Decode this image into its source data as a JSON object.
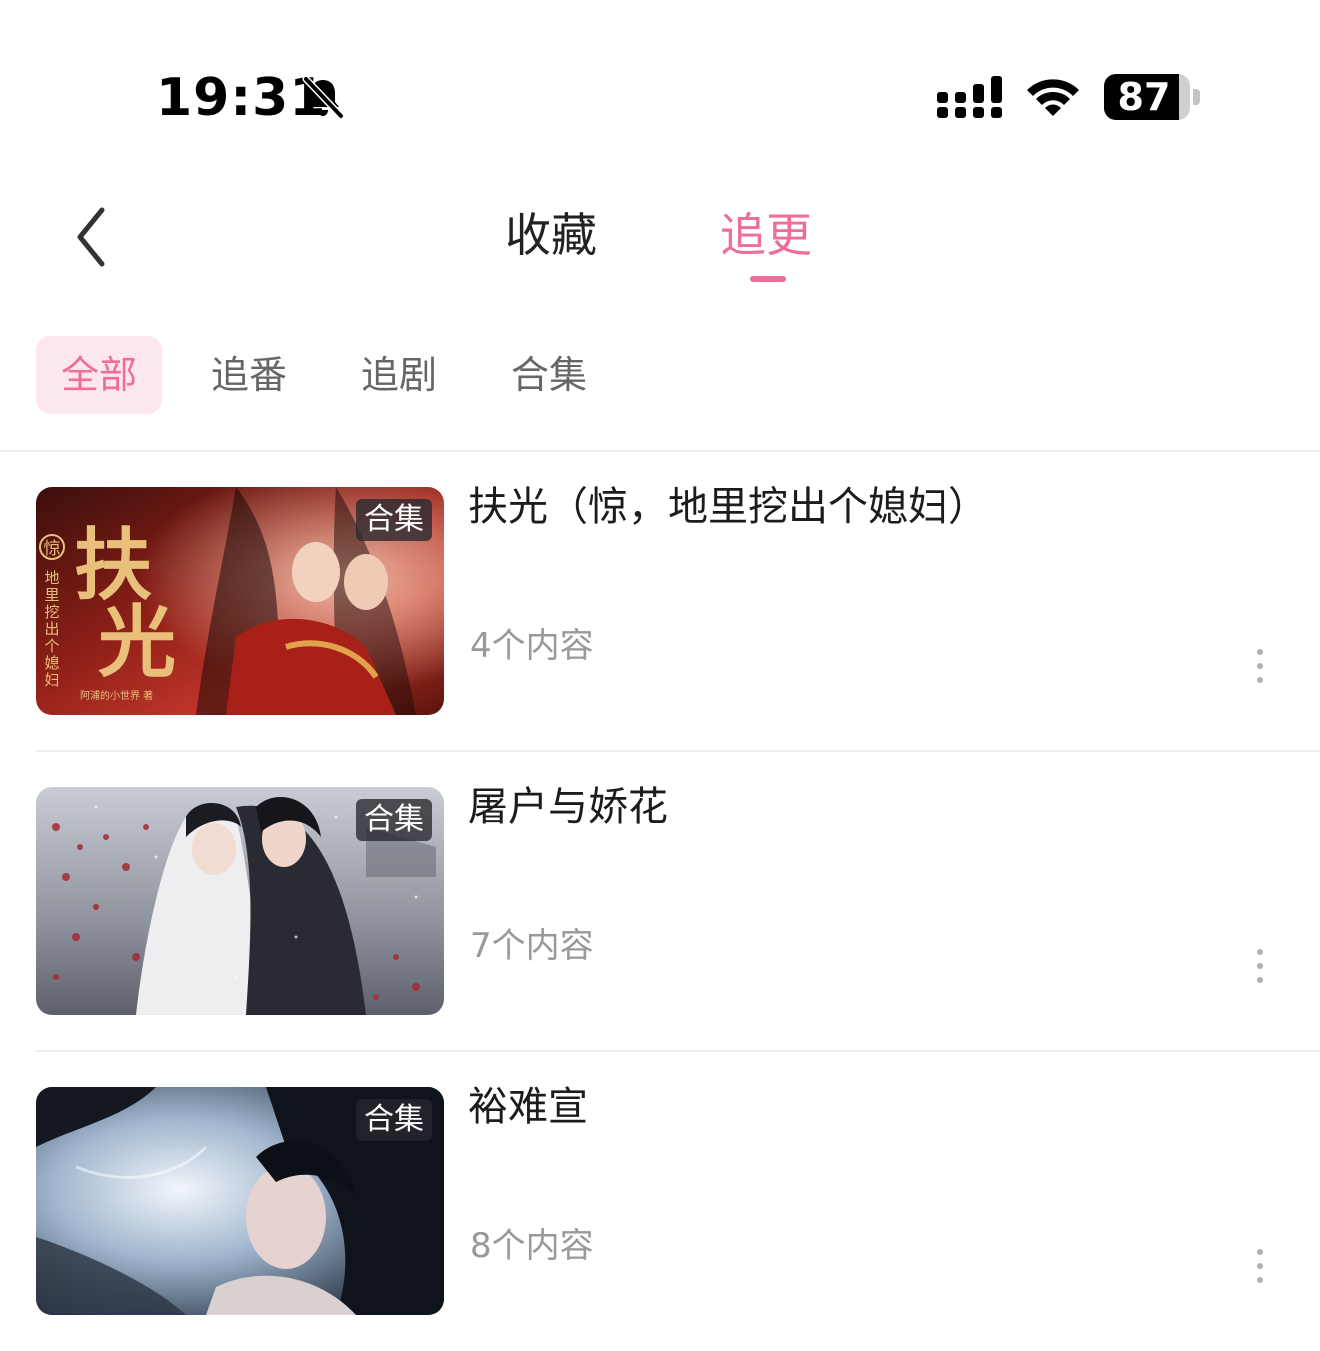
{
  "status_bar": {
    "time": "19:31",
    "battery": "87",
    "battery_level": 0.87,
    "icons": [
      "bell-muted-icon",
      "signal-icon",
      "wifi-icon",
      "battery-icon"
    ]
  },
  "header": {
    "back_icon": "chevron-left-icon",
    "tabs": [
      {
        "label": "收藏",
        "active": false
      },
      {
        "label": "追更",
        "active": true
      }
    ]
  },
  "filters": [
    {
      "label": "全部",
      "active": true
    },
    {
      "label": "追番",
      "active": false
    },
    {
      "label": "追剧",
      "active": false
    },
    {
      "label": "合集",
      "active": false
    }
  ],
  "items": [
    {
      "title": "扶光（惊，地里挖出个媳妇）",
      "badge": "合集",
      "count": "4个内容",
      "cover_text": "扶光",
      "cover_subtitle": "地里挖出个媳妇",
      "cover_seal": "惊",
      "cover_author": "阿浦的小世界 著"
    },
    {
      "title": "屠户与娇花",
      "badge": "合集",
      "count": "7个内容"
    },
    {
      "title": "裕难宣",
      "badge": "合集",
      "count": "8个内容"
    }
  ],
  "colors": {
    "accent": "#ee6e9a",
    "accent_bg": "#fde7ef",
    "muted_text": "#999999",
    "divider": "#ececec"
  }
}
